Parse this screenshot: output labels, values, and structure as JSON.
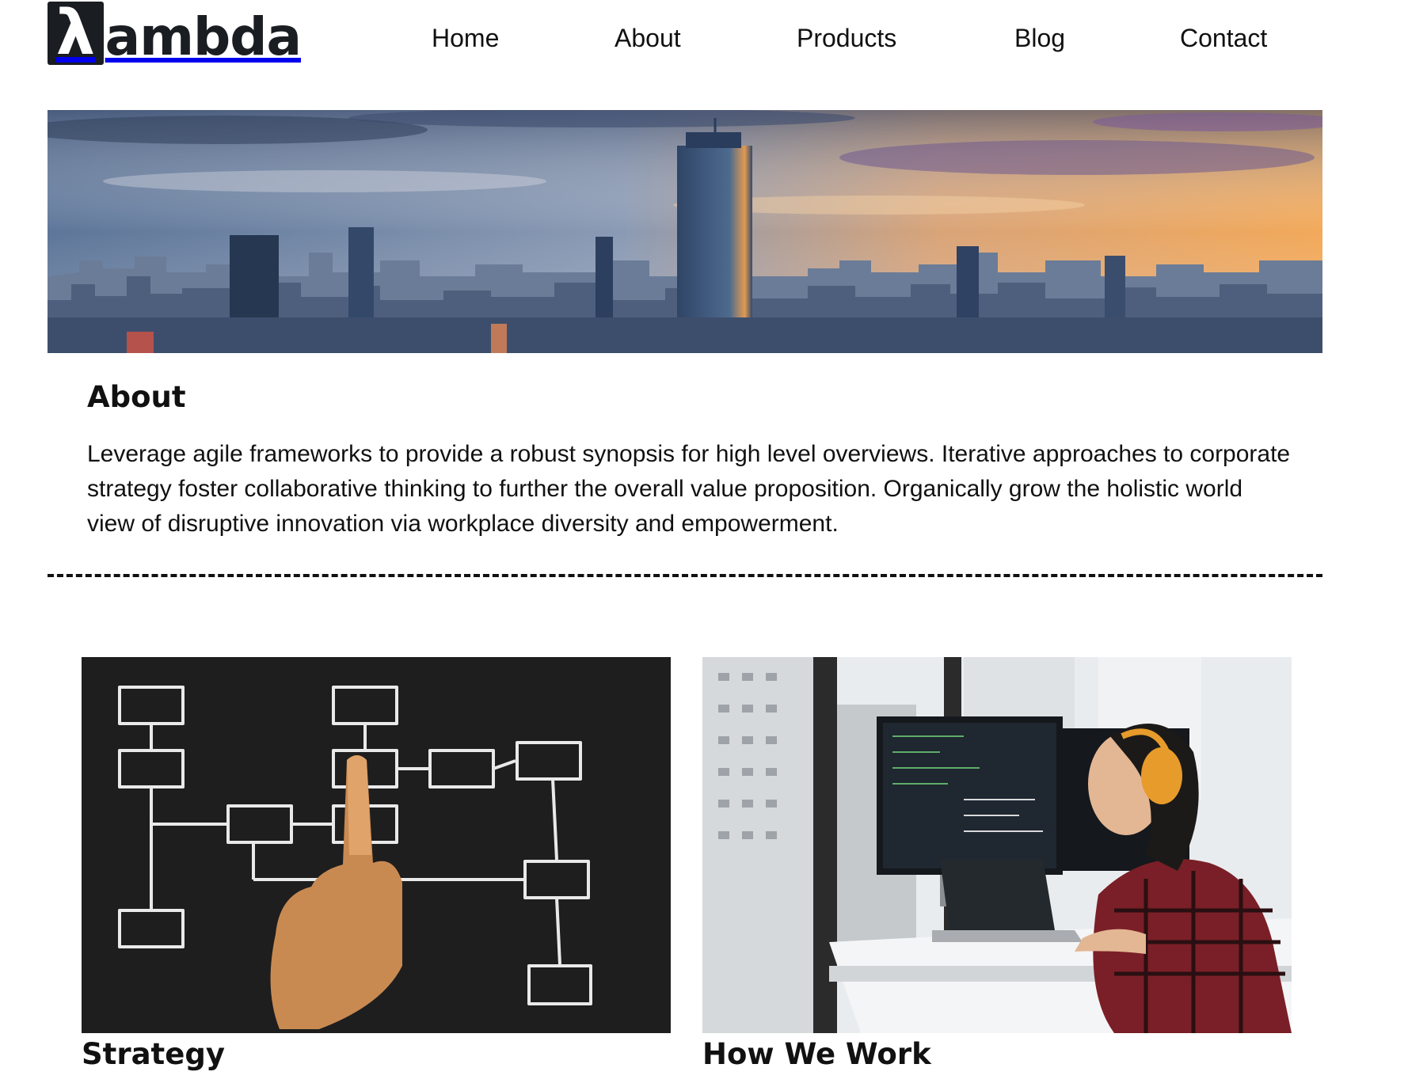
{
  "header": {
    "logo": {
      "glyph": "λ",
      "text": "ambda"
    },
    "nav": [
      {
        "label": "Home"
      },
      {
        "label": "About"
      },
      {
        "label": "Products"
      },
      {
        "label": "Blog"
      },
      {
        "label": "Contact"
      }
    ]
  },
  "about": {
    "title": "About",
    "body": "Leverage agile frameworks to provide a robust synopsis for high level overviews. Iterative approaches to corporate strategy foster collaborative thinking to further the overall value proposition. Organically grow the holistic world view of disruptive innovation via workplace diversity and empowerment."
  },
  "cards": [
    {
      "title": "Strategy"
    },
    {
      "title": "How We Work"
    }
  ],
  "colors": {
    "text": "#111111",
    "logo_bg": "#1a1d22",
    "chalkboard": "#1e1e1e",
    "sky_orange": "#f2a95a",
    "sky_purple": "#6d5a8f"
  }
}
